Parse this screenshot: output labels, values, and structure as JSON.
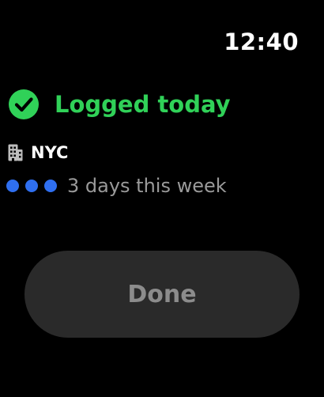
{
  "status": {
    "time": "12:40"
  },
  "header": {
    "title": "Logged today",
    "icon": "checkmark-circle-icon"
  },
  "location": {
    "icon": "building-icon",
    "label": "NYC"
  },
  "week": {
    "dots_count": 3,
    "label": "3 days this week"
  },
  "actions": {
    "done_label": "Done"
  },
  "colors": {
    "background": "#000000",
    "accent_green": "#30d158",
    "dot_blue": "#2f6ff0",
    "secondary_text": "#9a9a9a",
    "button_bg": "#2a2a2a",
    "button_text": "#8c8c8c",
    "icon_gray": "#bdbdbd"
  }
}
